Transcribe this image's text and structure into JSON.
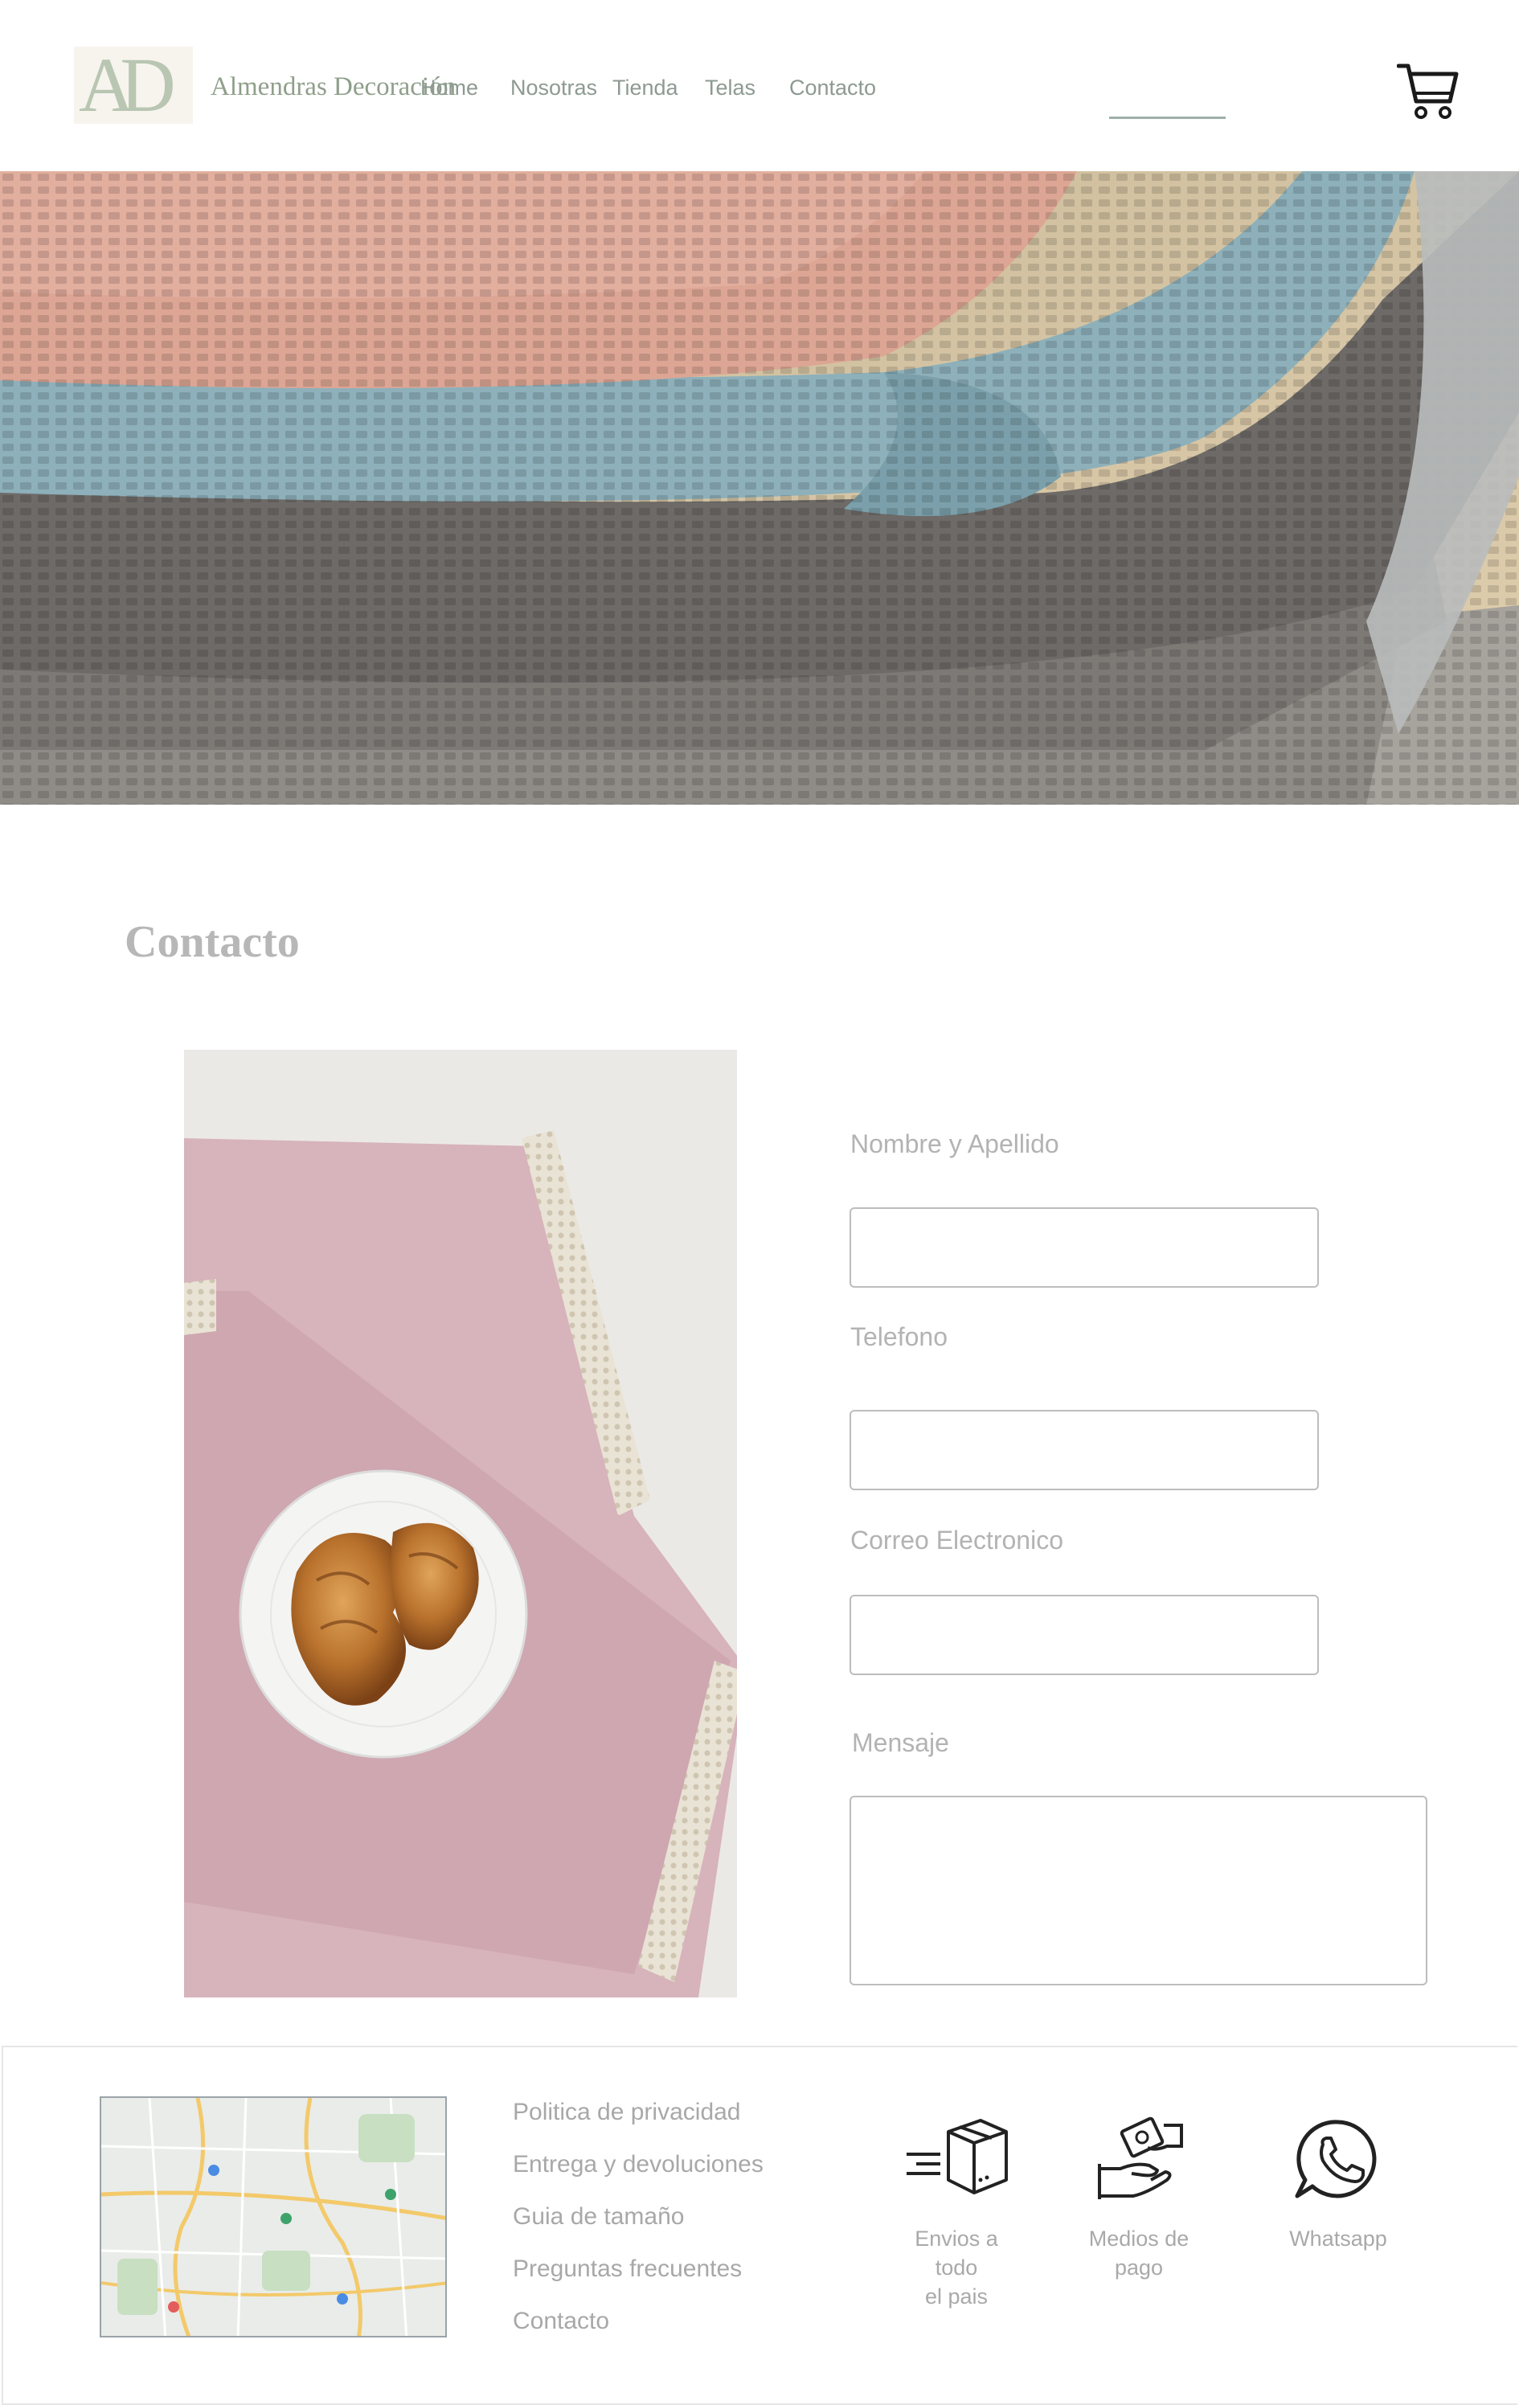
{
  "header": {
    "logo_letters": "AD",
    "brand_name": "Almendras Decoración",
    "nav": [
      {
        "label": "Home"
      },
      {
        "label": "Nosotras"
      },
      {
        "label": "Tienda"
      },
      {
        "label": "Telas",
        "active": true
      },
      {
        "label": "Contacto"
      }
    ],
    "cart_icon": "shopping-cart-icon"
  },
  "hero": {
    "image": "folded waffle-weave blankets in pink, blue and grey"
  },
  "contact": {
    "title": "Contacto",
    "photo": "croissants on a plate over a pink lace-trimmed napkin",
    "fields": {
      "name_label": "Nombre y Apellido",
      "phone_label": "Telefono",
      "email_label": "Correo Electronico",
      "message_label": "Mensaje"
    }
  },
  "footer": {
    "links": [
      "Politica de privacidad",
      "Entrega y devoluciones",
      "Guia de tamaño",
      "Preguntas frecuentes",
      "Contacto"
    ],
    "features": [
      {
        "line1": "Envios a todo",
        "line2": "el pais",
        "icon": "delivery-box-icon"
      },
      {
        "line1": "Medios de",
        "line2": "pago",
        "icon": "payment-hands-icon"
      },
      {
        "line1": "Whatsapp",
        "line2": "",
        "icon": "whatsapp-icon"
      }
    ]
  },
  "colors": {
    "brand_green": "#8f9f8a",
    "nav_text": "#8d9a92",
    "nav_active_underline": "#9db0a8",
    "label_grey": "#b3b3b3"
  }
}
